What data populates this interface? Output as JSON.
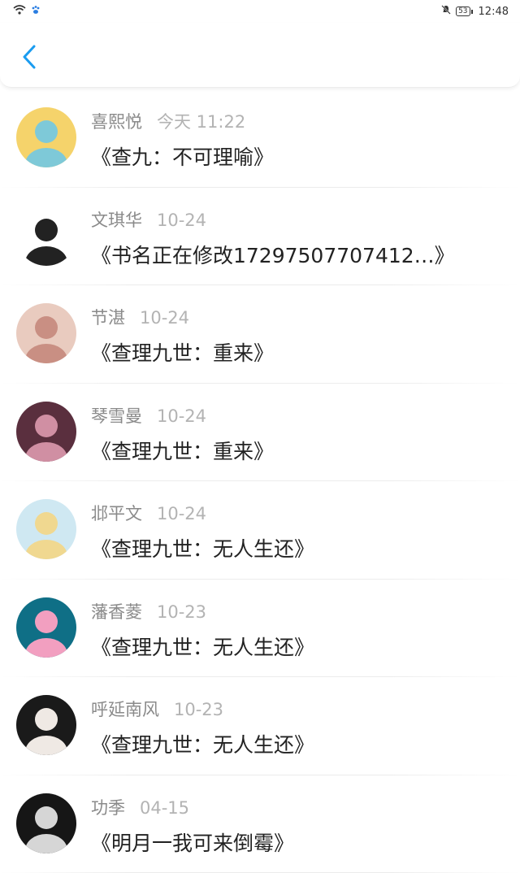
{
  "status_bar": {
    "time": "12:48",
    "battery": "53"
  },
  "header": {
    "back_icon": "chevron-left-icon",
    "accent_color": "#1a9cf0"
  },
  "feed": [
    {
      "name": "喜熙悦",
      "time": "今天 11:22",
      "title": "《查九：不可理喻》",
      "avatar_colors": [
        "#f5d36b",
        "#7ec9d8"
      ]
    },
    {
      "name": "文琪华",
      "time": "10-24",
      "title": "《书名正在修改17297507707412…》",
      "avatar_colors": [
        "#ffffff",
        "#222222"
      ]
    },
    {
      "name": "节湛",
      "time": "10-24",
      "title": "《查理九世：重来》",
      "avatar_colors": [
        "#e9cbbf",
        "#c98f83"
      ]
    },
    {
      "name": "琴雪曼",
      "time": "10-24",
      "title": "《查理九世：重来》",
      "avatar_colors": [
        "#5a2f3e",
        "#d08fa3"
      ]
    },
    {
      "name": "邶平文",
      "time": "10-24",
      "title": "《查理九世：无人生还》",
      "avatar_colors": [
        "#cfe8f2",
        "#f0d890"
      ]
    },
    {
      "name": "藩香菱",
      "time": "10-23",
      "title": "《查理九世：无人生还》",
      "avatar_colors": [
        "#0f6f86",
        "#f29fc0"
      ]
    },
    {
      "name": "呼延南风",
      "time": "10-23",
      "title": "《查理九世：无人生还》",
      "avatar_colors": [
        "#1a1a1a",
        "#efe9e4"
      ]
    },
    {
      "name": "功季",
      "time": "04-15",
      "title": "《明月一我可来倒霉》",
      "avatar_colors": [
        "#161616",
        "#d6d6d6"
      ]
    }
  ]
}
